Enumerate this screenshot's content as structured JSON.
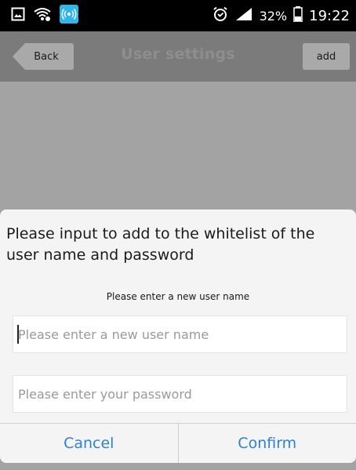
{
  "status_bar": {
    "battery": "32%",
    "time": "19:22"
  },
  "header": {
    "back_label": "Back",
    "title": "User settings",
    "add_label": "add"
  },
  "dialog": {
    "title": "Please input to add to the whitelist of the user name and password",
    "subtitle": "Please enter a new user name",
    "username_placeholder": "Please enter a new user name",
    "password_placeholder": "Please enter your password",
    "cancel_label": "Cancel",
    "confirm_label": "Confirm"
  },
  "colors": {
    "accent": "#2f82cf",
    "overlay": "#a3a3a3",
    "header": "#7b7b7b",
    "status_bar": "#000000"
  },
  "icons": {
    "status_left": [
      "image-icon",
      "wifi-icon",
      "hotspot-icon"
    ],
    "status_right": [
      "alarm-icon",
      "signal-icon",
      "battery-icon"
    ]
  }
}
